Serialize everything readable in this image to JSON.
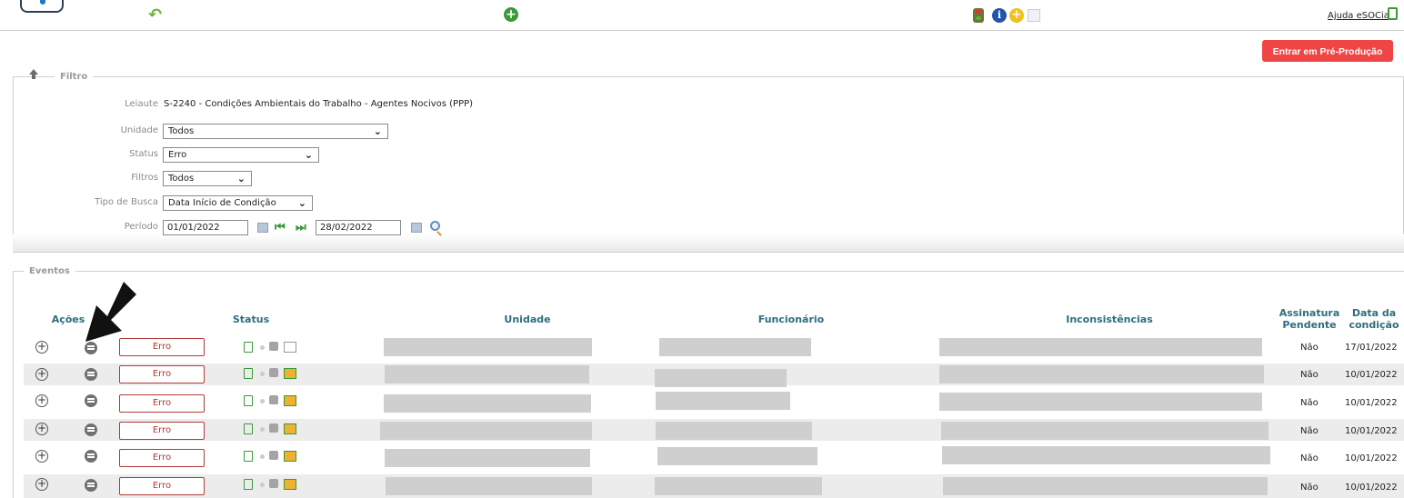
{
  "toolbar": {
    "help_label": "Ajuda eSOCial"
  },
  "preprod_button": "Entrar em Pré-Produção",
  "filter": {
    "legend": "Filtro",
    "layout_label": "Leiaute",
    "layout_value": "S-2240 - Condições Ambientais do Trabalho - Agentes Nocivos (PPP)",
    "unidade_label": "Unidade",
    "unidade_value": "Todos",
    "status_label": "Status",
    "status_value": "Erro",
    "filtros_label": "Filtros",
    "filtros_value": "Todos",
    "tipo_busca_label": "Tipo de Busca",
    "tipo_busca_value": "Data Início de Condição",
    "periodo_label": "Período",
    "periodo_start": "01/01/2022",
    "periodo_end": "28/02/2022"
  },
  "events": {
    "legend": "Eventos",
    "columns": {
      "acoes": "Ações",
      "status": "Status",
      "unidade": "Unidade",
      "funcionario": "Funcionário",
      "inconsistencias": "Inconsistências",
      "assinatura_1": "Assinatura",
      "assinatura_2": "Pendente",
      "data_1": "Data da",
      "data_2": "condição"
    },
    "rows": [
      {
        "status": "Erro",
        "assinatura": "Não",
        "data": "17/01/2022"
      },
      {
        "status": "Erro",
        "assinatura": "Não",
        "data": "10/01/2022"
      },
      {
        "status": "Erro",
        "assinatura": "Não",
        "data": "10/01/2022"
      },
      {
        "status": "Erro",
        "assinatura": "Não",
        "data": "10/01/2022"
      },
      {
        "status": "Erro",
        "assinatura": "Não",
        "data": "10/01/2022"
      },
      {
        "status": "Erro",
        "assinatura": "Não",
        "data": "10/01/2022"
      }
    ]
  },
  "icons": {
    "back": "back-icon",
    "undo": "undo-icon",
    "add": "add-icon",
    "traffic_light": "traffic-light-icon",
    "info": "info-icon",
    "add_yellow": "add-yellow-icon",
    "document": "document-icon",
    "help_doc": "help-doc-icon",
    "calendar": "calendar-icon",
    "prev": "first-prev-icon",
    "next": "next-last-icon",
    "search": "search-icon",
    "expand": "plus-circle-icon",
    "menu": "menu-icon",
    "pointer": "arrow-pointer-icon"
  },
  "colors": {
    "accent_red": "#f04545",
    "header_teal": "#2d6e7e",
    "error_border": "#b23a3a",
    "green": "#3a9a3a"
  }
}
